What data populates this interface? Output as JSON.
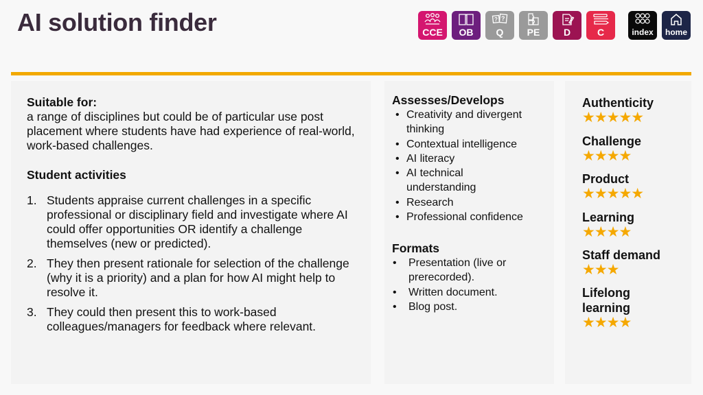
{
  "header": {
    "title": "AI solution finder",
    "nav": [
      {
        "id": "cce",
        "label": "CCE",
        "icon": "people-group-icon",
        "color": "#d4166f"
      },
      {
        "id": "ob",
        "label": "OB",
        "icon": "open-book-icon",
        "color": "#6d1f7e"
      },
      {
        "id": "q",
        "label": "Q",
        "icon": "question-cards-icon",
        "color": "#9a9a9a"
      },
      {
        "id": "pe",
        "label": "PE",
        "icon": "puzzle-icon",
        "color": "#9a9a9a"
      },
      {
        "id": "d",
        "label": "D",
        "icon": "document-pen-icon",
        "color": "#9c1352"
      },
      {
        "id": "c",
        "label": "C",
        "icon": "pens-icon",
        "color": "#e6294a"
      },
      {
        "id": "index",
        "label": "index",
        "icon": "grid-circles-icon",
        "color": "#0a0a0a"
      },
      {
        "id": "home",
        "label": "home",
        "icon": "house-icon",
        "color": "#1d2547"
      }
    ],
    "accent": "#f2a900"
  },
  "left": {
    "suitable_heading": "Suitable for:",
    "suitable_text": "a range of disciplines but could be of particular use post placement where students have had experience of real-world, work-based challenges.",
    "activities_heading": "Student activities",
    "activities": [
      {
        "num": "1.",
        "text": "Students appraise current challenges in a specific professional or disciplinary field and investigate where AI could offer opportunities OR identify a challenge themselves (new or predicted)."
      },
      {
        "num": "2.",
        "text": "They then present rationale for selection of the challenge (why it is a priority) and a plan for how AI might help to resolve it."
      },
      {
        "num": "3.",
        "text": "They could then present this to work-based colleagues/managers for feedback where relevant."
      }
    ]
  },
  "middle": {
    "assesses_heading": "Assesses/Develops",
    "assesses": [
      "Creativity and divergent thinking",
      "Contextual intelligence",
      "AI literacy",
      "AI technical understanding",
      "Research",
      "Professional confidence"
    ],
    "formats_heading": "Formats",
    "formats": [
      "Presentation (live or prerecorded).",
      "Written document.",
      "Blog post."
    ]
  },
  "right": {
    "star_color": "#f5a800",
    "criteria": [
      {
        "name": "Authenticity",
        "rating": 5,
        "stars": "★★★★★"
      },
      {
        "name": "Challenge",
        "rating": 4,
        "stars": "★★★★"
      },
      {
        "name": "Product",
        "rating": 5,
        "stars": "★★★★★"
      },
      {
        "name": "Learning",
        "rating": 4,
        "stars": "★★★★"
      },
      {
        "name": "Staff demand",
        "rating": 3,
        "stars": "★★★"
      },
      {
        "name": "Lifelong learning",
        "rating": 4,
        "stars": "★★★★"
      }
    ]
  }
}
